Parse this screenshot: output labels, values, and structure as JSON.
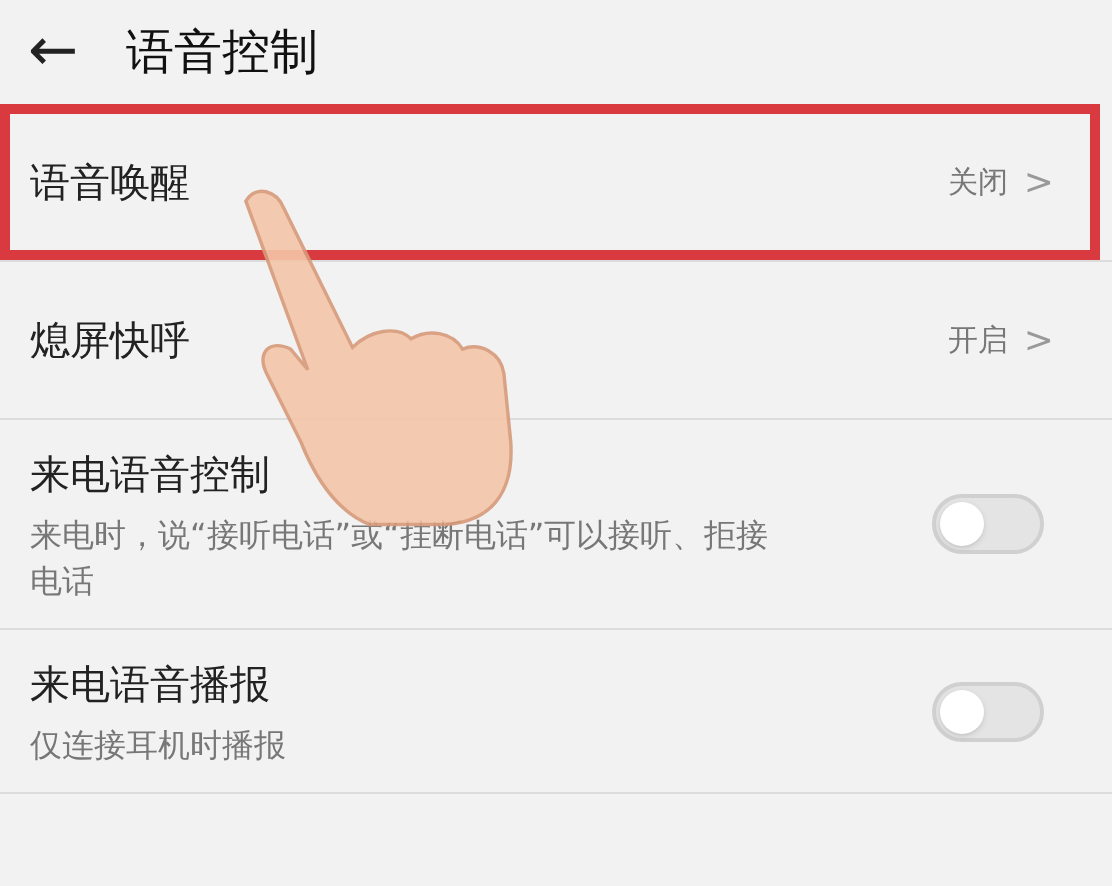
{
  "header": {
    "back": "←",
    "title": "语音控制"
  },
  "rows": [
    {
      "kind": "link",
      "title": "语音唤醒",
      "value": "关闭",
      "chevron": ">",
      "highlighted": true
    },
    {
      "kind": "link",
      "title": "熄屏快呼",
      "value": "开启",
      "chevron": ">",
      "highlighted": false
    },
    {
      "kind": "toggle",
      "title": "来电语音控制",
      "subtitle": "来电时，说“接听电话”或“挂断电话”可以接听、拒接电话",
      "on": false
    },
    {
      "kind": "toggle",
      "title": "来电语音播报",
      "subtitle": "仅连接耳机时播报",
      "on": false
    }
  ]
}
